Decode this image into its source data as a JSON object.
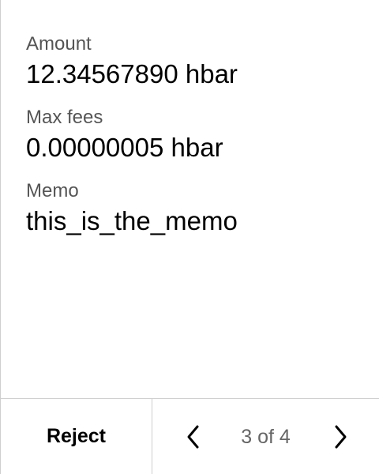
{
  "fields": [
    {
      "label": "Amount",
      "value": "12.34567890 hbar"
    },
    {
      "label": "Max fees",
      "value": "0.00000005 hbar"
    },
    {
      "label": "Memo",
      "value": "this_is_the_memo"
    }
  ],
  "footer": {
    "reject_label": "Reject",
    "page_indicator": "3 of 4",
    "prev_icon": "chevron-left-icon",
    "next_icon": "chevron-right-icon"
  },
  "colors": {
    "label": "#555555",
    "value": "#000000",
    "divider": "#cfcfcf",
    "page_indicator": "#666666"
  }
}
